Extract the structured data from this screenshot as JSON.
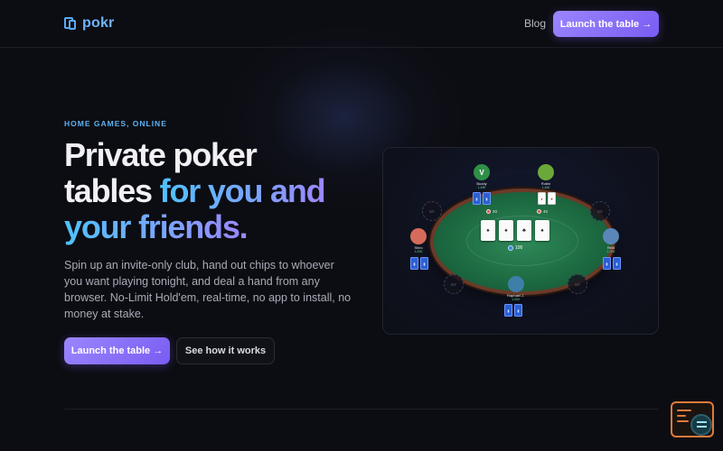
{
  "brand": {
    "name": "pokr",
    "accent": "#6fb4ff",
    "primary": "#8b6ff7"
  },
  "nav": {
    "blog": "Blog",
    "cta": "Launch the table →"
  },
  "hero": {
    "eyebrow": "HOME GAMES, ONLINE",
    "title_line1": "Private poker",
    "title_line2a": "tables ",
    "title_line2b": "for you and",
    "title_line3": "your friends.",
    "description": "Spin up an invite-only club, hand out chips to whoever you want playing tonight, and deal a hand from any browser. No-Limit Hold'em, real-time, no app to install, no money at stake.",
    "cta_primary": "Launch the table →",
    "cta_secondary": "See how it works"
  },
  "table_preview": {
    "pot": "100",
    "board": [
      "♠",
      "♠",
      "♣",
      "♠"
    ],
    "bets": [
      "20",
      "40"
    ],
    "players": [
      {
        "name": "Buddy",
        "stack": "1,480",
        "initial": "V",
        "color": "#2f8f46"
      },
      {
        "name": "Robin",
        "stack": "1,460",
        "initial": "",
        "color": "#6ba83a"
      },
      {
        "name": "Shiro",
        "stack": "1,000",
        "initial": "",
        "color": "#d56b5b"
      },
      {
        "name": "Reid",
        "stack": "1,000",
        "initial": "",
        "color": "#5a87b8"
      },
      {
        "name": "Raphael J.",
        "stack": "1,000",
        "initial": "",
        "color": "#3d7fa8"
      }
    ],
    "empty_seat": "SIT"
  },
  "widget": {
    "icon": "console-search-icon"
  }
}
